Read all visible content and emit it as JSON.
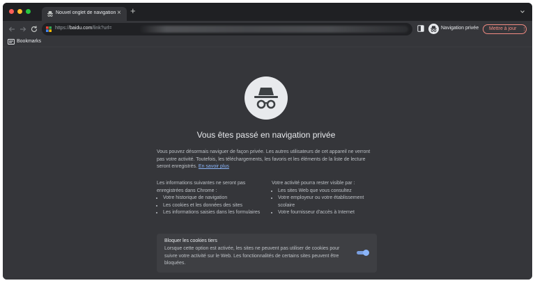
{
  "tab": {
    "title": "Nouvel onglet de navigation pr",
    "close": "×",
    "new_tab": "+"
  },
  "toolbar": {
    "url_prefix": "https://",
    "url_domain": "baidu.com",
    "url_path": "/link?url=",
    "incognito_label": "Navigation privée",
    "update_label": "Mettre à jour",
    "update_menu": "⋮"
  },
  "bookmarks": {
    "label": "Bookmarks"
  },
  "content": {
    "heading": "Vous êtes passé en navigation privée",
    "intro_text": "Vous pouvez désormais naviguer de façon privée. Les autres utilisateurs de cet appareil ne verront pas votre activité. Toutefois, les téléchargements, les favoris et les éléments de la liste de lecture seront enregistrés. ",
    "learn_more": "En savoir plus",
    "left_col": {
      "title": "Les informations suivantes ne seront pas enregistrées dans Chrome :",
      "items": [
        "Votre historique de navigation",
        "Les cookies et les données des sites",
        "Les informations saisies dans les formulaires"
      ]
    },
    "right_col": {
      "title": "Votre activité pourra rester visible par :",
      "items": [
        "Les sites Web que vous consultez",
        "Votre employeur ou votre établissement scolaire",
        "Votre fournisseur d'accès à Internet"
      ]
    },
    "cookies": {
      "title": "Bloquer les cookies tiers",
      "description": "Lorsque cette option est activée, les sites ne peuvent pas utiliser de cookies pour suivre votre activité sur le Web. Les fonctionnalités de certains sites peuvent être bloquées.",
      "enabled": true
    }
  },
  "colors": {
    "close_dot": "#ff5f57",
    "minimize_dot": "#febc2e",
    "maximize_dot": "#28c840",
    "accent_blue": "#8ab4f8",
    "update_red": "#f28b82"
  }
}
